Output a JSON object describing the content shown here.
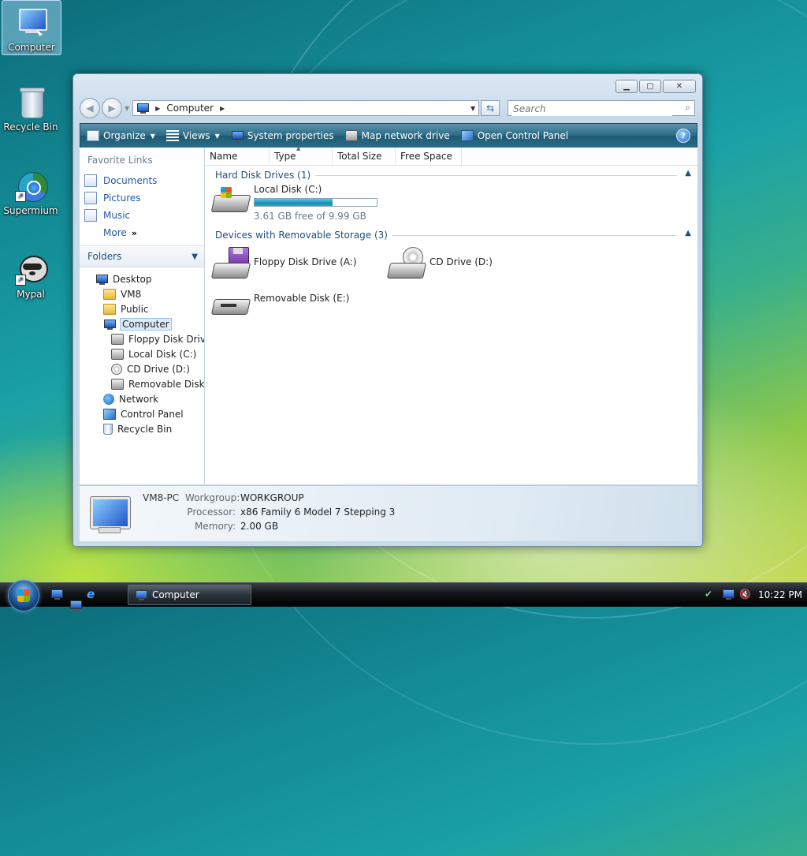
{
  "desktop": {
    "icons": [
      {
        "label": "Computer"
      },
      {
        "label": "Recycle Bin"
      },
      {
        "label": "Supermium"
      },
      {
        "label": "Mypal"
      }
    ]
  },
  "window": {
    "address": {
      "crumb": "Computer"
    },
    "search": {
      "placeholder": "Search"
    },
    "toolbar": {
      "organize": "Organize",
      "views": "Views",
      "system_properties": "System properties",
      "map_network_drive": "Map network drive",
      "open_control_panel": "Open Control Panel"
    },
    "favorites": {
      "title": "Favorite Links",
      "items": [
        "Documents",
        "Pictures",
        "Music"
      ],
      "more": "More"
    },
    "folders": {
      "title": "Folders",
      "tree": [
        {
          "label": "Desktop",
          "icon": "monitor-icon"
        },
        {
          "label": "VM8",
          "icon": "user-folder-icon"
        },
        {
          "label": "Public",
          "icon": "folder-icon"
        },
        {
          "label": "Computer",
          "icon": "computer-icon"
        },
        {
          "label": "Floppy Disk Drive",
          "icon": "floppy-drive-icon"
        },
        {
          "label": "Local Disk (C:)",
          "icon": "hard-disk-icon"
        },
        {
          "label": "CD Drive (D:)",
          "icon": "cd-drive-icon"
        },
        {
          "label": "Removable Disk (E:)",
          "icon": "removable-disk-icon"
        },
        {
          "label": "Network",
          "icon": "network-icon"
        },
        {
          "label": "Control Panel",
          "icon": "control-panel-icon"
        },
        {
          "label": "Recycle Bin",
          "icon": "recycle-bin-icon"
        }
      ]
    },
    "columns": [
      "Name",
      "Type",
      "Total Size",
      "Free Space"
    ],
    "groups": {
      "hard": {
        "title": "Hard Disk Drives (1)",
        "drives": [
          {
            "name": "Local Disk (C:)",
            "free_text": "3.61 GB free of 9.99 GB",
            "used_fraction": 0.64
          }
        ]
      },
      "removable": {
        "title": "Devices with Removable Storage (3)",
        "drives": [
          {
            "name": "Floppy Disk Drive (A:)"
          },
          {
            "name": "CD Drive (D:)"
          },
          {
            "name": "Removable Disk (E:)"
          }
        ]
      }
    },
    "details": {
      "pc_name": "VM8-PC",
      "workgroup_label": "Workgroup:",
      "workgroup": "WORKGROUP",
      "processor_label": "Processor:",
      "processor": "x86 Family 6 Model 7 Stepping 3",
      "memory_label": "Memory:",
      "memory": "2.00 GB"
    }
  },
  "taskbar": {
    "task": "Computer",
    "clock": "10:22 PM"
  },
  "colors": {
    "toolbar": "#2b6a85",
    "link": "#1e5aa8",
    "capacity_fill": "#1b8bb7"
  }
}
